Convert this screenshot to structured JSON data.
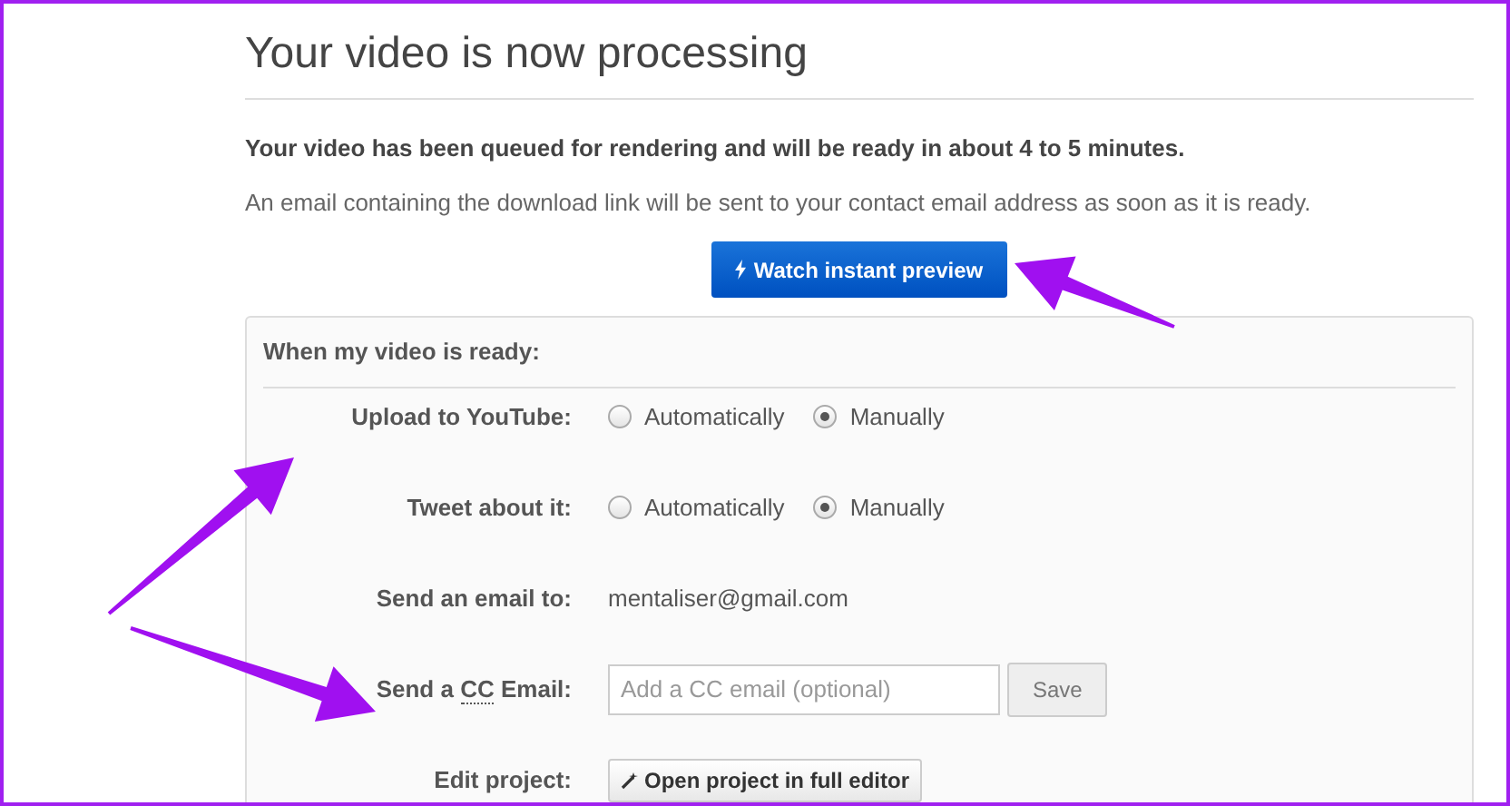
{
  "title": "Your video is now processing",
  "notice": "Your video has been queued for rendering and will be ready in about 4 to 5 minutes.",
  "info": "An email containing the download link will be sent to your contact email address as soon as it is ready.",
  "preview_button": {
    "label": "Watch instant preview"
  },
  "panel": {
    "heading": "When my video is ready:",
    "rows": [
      {
        "kind": "radio",
        "label": "Upload to YouTube:",
        "options": [
          {
            "label": "Automatically",
            "selected": false
          },
          {
            "label": "Manually",
            "selected": true
          }
        ]
      },
      {
        "kind": "radio",
        "label": "Tweet about it:",
        "options": [
          {
            "label": "Automatically",
            "selected": false
          },
          {
            "label": "Manually",
            "selected": true
          }
        ]
      },
      {
        "kind": "text",
        "label": "Send an email to:",
        "value": "mentaliser@gmail.com"
      },
      {
        "kind": "field",
        "label_before": "Send a",
        "abbr": "CC",
        "label_after": "Email:",
        "placeholder": "Add a CC email (optional)",
        "button": "Save"
      },
      {
        "kind": "button",
        "label": "Edit project:",
        "button": "Open project in full editor"
      }
    ]
  }
}
